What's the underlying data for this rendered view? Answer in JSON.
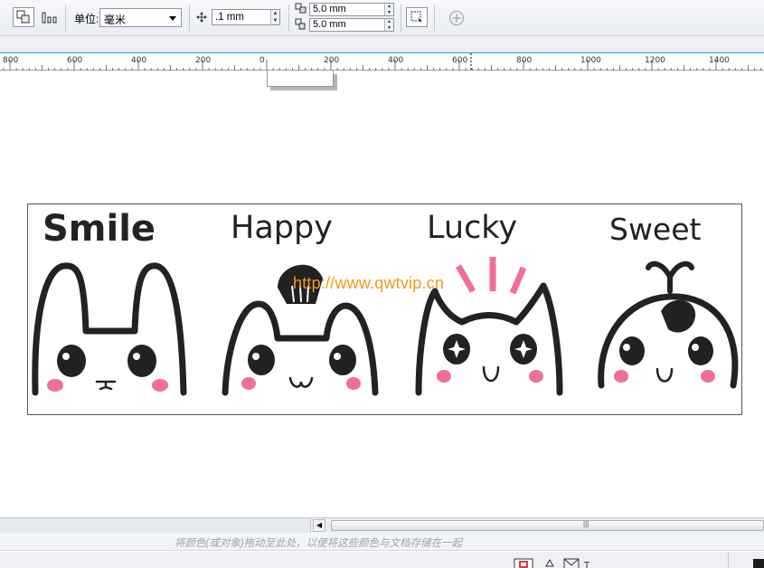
{
  "toolbar": {
    "unit_label": "单位:",
    "unit_value": "毫米",
    "nudge_value": ".1 mm",
    "dup_x": "5.0 mm",
    "dup_y": "5.0 mm",
    "icons": [
      "copy-properties-icon",
      "align-icon",
      "nudge-icon",
      "duplicate-x-icon",
      "duplicate-y-icon",
      "treat-as-filled-icon",
      "add-icon"
    ]
  },
  "ruler": {
    "labels": [
      "800",
      "600",
      "400",
      "200",
      "0",
      "200",
      "400",
      "600",
      "800",
      "1000",
      "1200",
      "1400"
    ]
  },
  "artwork": {
    "titles": [
      "Smile",
      "Happy",
      "Lucky",
      "Sweet"
    ],
    "watermark": "http://www.qwtvip.cn"
  },
  "hint_text": "将颜色(或对象)拖动至此处，以便将这些颜色与文档存储在一起",
  "colors": {
    "accent_blue": "#2aa8e0",
    "pink": "#ef6f9a",
    "ink": "#222222",
    "watermark": "#f29a1a"
  }
}
